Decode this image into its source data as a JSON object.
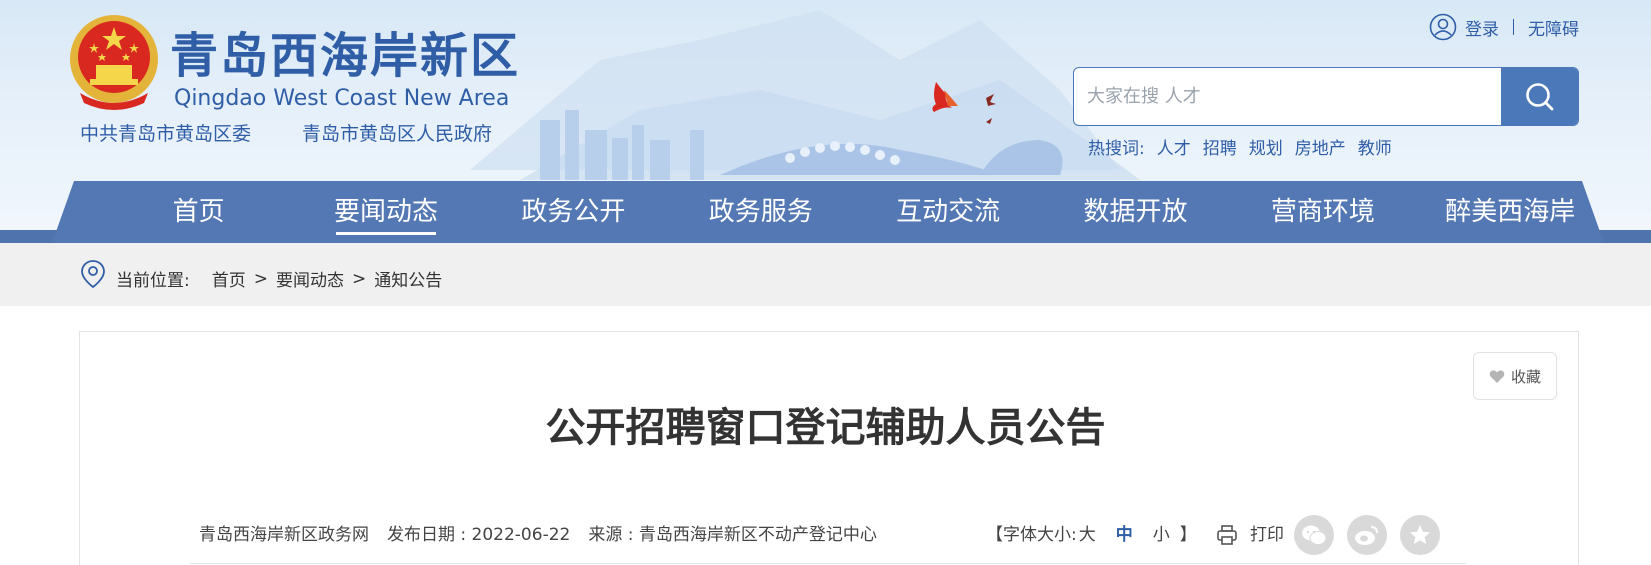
{
  "header": {
    "site_title": "青岛西海岸新区",
    "site_subtitle": "Qingdao West Coast New Area",
    "org_party": "中共青岛市黄岛区委",
    "org_government": "青岛市黄岛区人民政府",
    "login_label": "登录",
    "accessibility_label": "无障碍",
    "search": {
      "placeholder": "大家在搜 人才"
    },
    "hot_label": "热搜词:",
    "hot_words": [
      "人才",
      "招聘",
      "规划",
      "房地产",
      "教师"
    ]
  },
  "nav": {
    "items": [
      "首页",
      "要闻动态",
      "政务公开",
      "政务服务",
      "互动交流",
      "数据开放",
      "营商环境",
      "醉美西海岸"
    ],
    "active_index": 1
  },
  "breadcrumb": {
    "label": "当前位置:",
    "items": [
      "首页",
      "要闻动态",
      "通知公告"
    ],
    "separator": ">"
  },
  "article": {
    "favorite_label": "收藏",
    "title": "公开招聘窗口登记辅助人员公告",
    "site_name": "青岛西海岸新区政务网",
    "publish_date": "发布日期 : 2022-06-22",
    "source": "来源 : 青岛西海岸新区不动产登记中心",
    "font_size": {
      "open_bracket": "【",
      "label": "字体大小:",
      "large": "大",
      "medium": "中",
      "small": "小",
      "close_bracket": "】",
      "current": "medium"
    },
    "print_label": "打印",
    "share_icons": [
      "wechat-icon",
      "weibo-icon",
      "favorite-star-icon"
    ]
  },
  "colors": {
    "brand_blue": "#2f5ea7",
    "nav_blue": "#5478b3",
    "search_blue": "#4a78b8",
    "breadcrumb_bg": "#f0f0f0"
  }
}
